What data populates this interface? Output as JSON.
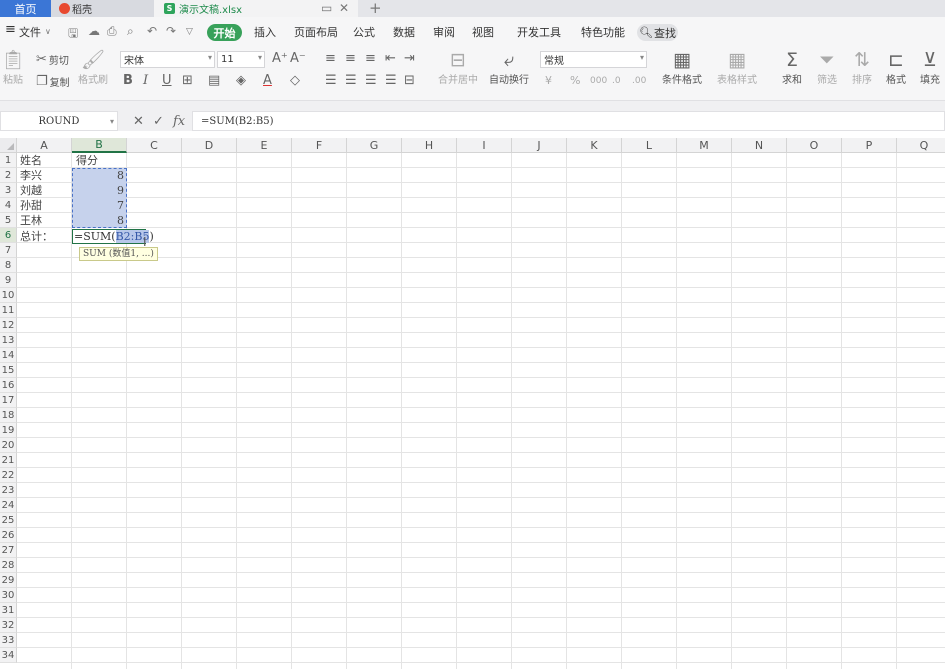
{
  "tabs": {
    "home": "首页",
    "daoke": "稻壳",
    "file": "演示文稿.xlsx",
    "new_tab": "+"
  },
  "menu": {
    "hamburger": "≡",
    "file": "文件",
    "start": "开始",
    "insert": "插入",
    "page_layout": "页面布局",
    "formula": "公式",
    "data": "数据",
    "review": "审阅",
    "view": "视图",
    "developer": "开发工具",
    "special": "特色功能",
    "search": "查找"
  },
  "ribbon": {
    "paste": "粘贴",
    "cut": "剪切",
    "copy": "复制",
    "format_painter": "格式刷",
    "font_name": "宋体",
    "font_size": "11",
    "merge_center": "合并居中",
    "wrap_text": "自动换行",
    "number_format": "常规",
    "conditional_format": "条件格式",
    "table_style": "表格样式",
    "sum": "求和",
    "filter": "筛选",
    "sort": "排序",
    "format": "格式",
    "fill": "填充"
  },
  "formula_bar": {
    "name_box": "ROUND",
    "formula": "=SUM(B2:B5)"
  },
  "grid": {
    "columns": [
      "A",
      "B",
      "C",
      "D",
      "E",
      "F",
      "G",
      "H",
      "I",
      "J",
      "K",
      "L",
      "M",
      "N",
      "O",
      "P",
      "Q"
    ],
    "rows": [
      "1",
      "2",
      "3",
      "4",
      "5",
      "6",
      "7",
      "8",
      "9",
      "10",
      "11",
      "12",
      "13",
      "14",
      "15",
      "16",
      "17",
      "18",
      "19",
      "20",
      "21",
      "22",
      "23",
      "24",
      "25",
      "26",
      "27",
      "28",
      "29",
      "30",
      "31",
      "32",
      "33",
      "34"
    ],
    "selected_column": "B",
    "selected_row": "6",
    "cells": {
      "A1": "姓名",
      "B1": "得分",
      "A2": "李兴",
      "B2": "8",
      "A3": "刘越",
      "B3": "9",
      "A4": "孙甜",
      "B4": "7",
      "A5": "王林",
      "B5": "8",
      "A6": "总计："
    },
    "edit_prefix": "=SUM(",
    "edit_ref": "B2:B5",
    "edit_suffix": ")",
    "tooltip": "SUM (数值1, ...)"
  },
  "colors": {
    "accent_green": "#38a15a",
    "tab_blue": "#3b76d6",
    "selection_fill": "#c6d2ec"
  }
}
